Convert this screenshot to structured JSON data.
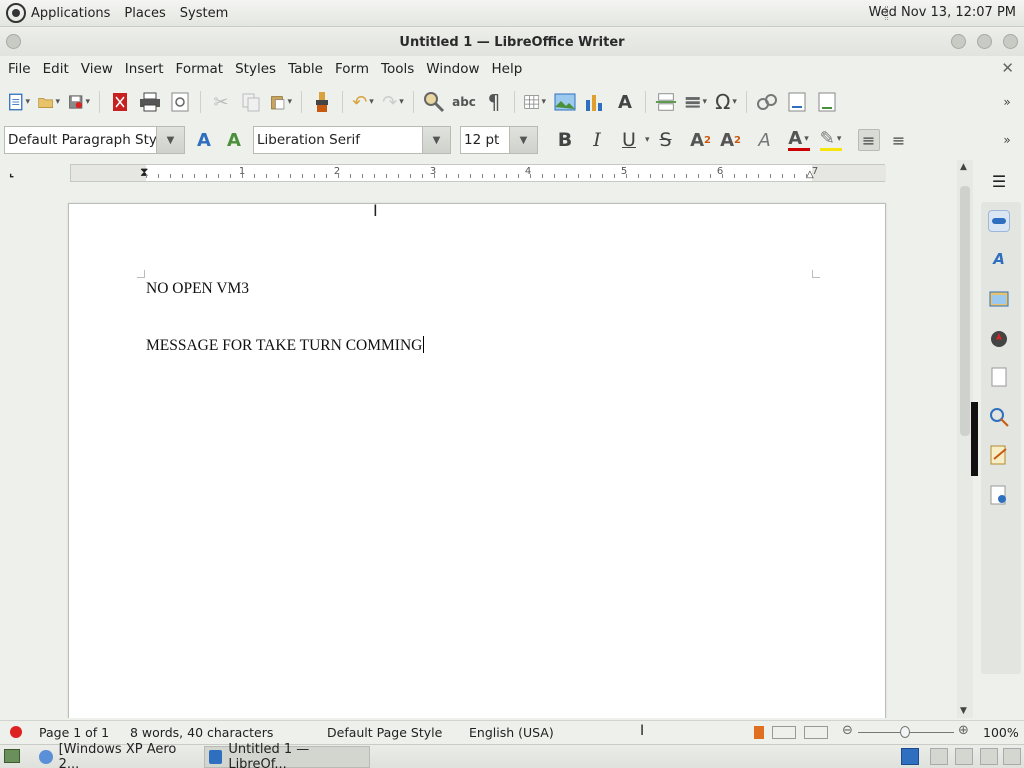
{
  "top_panel": {
    "menus": [
      "Applications",
      "Places",
      "System"
    ],
    "clock": "Wed Nov 13, 12:07 PM"
  },
  "window": {
    "title": "Untitled 1 — LibreOffice Writer"
  },
  "menubar": {
    "items": [
      "File",
      "Edit",
      "View",
      "Insert",
      "Format",
      "Styles",
      "Table",
      "Form",
      "Tools",
      "Window",
      "Help"
    ],
    "close_glyph": "✕"
  },
  "formatting": {
    "paragraph_style": "Default Paragraph Style",
    "font_name": "Liberation Serif",
    "font_size": "12 pt",
    "bold": "B",
    "italic": "I",
    "underline": "U",
    "strike": "S"
  },
  "ruler": {
    "numbers": [
      "1",
      "2",
      "3",
      "4",
      "5",
      "6",
      "7"
    ]
  },
  "document": {
    "paragraphs": [
      "NO OPEN VM3",
      "MESSAGE FOR TAKE TURN COMMING"
    ]
  },
  "statusbar": {
    "page": "Page 1 of 1",
    "word_count": "8 words, 40 characters",
    "page_style": "Default Page Style",
    "language": "English (USA)",
    "zoom": "100%"
  },
  "taskbar": {
    "items": [
      "[Windows XP Aero 2...",
      "Untitled 1 — LibreOf..."
    ]
  },
  "colors": {
    "font_color": "#cc0000",
    "highlight_color": "#f5e50a",
    "accent_blue": "#2f6fbf"
  }
}
